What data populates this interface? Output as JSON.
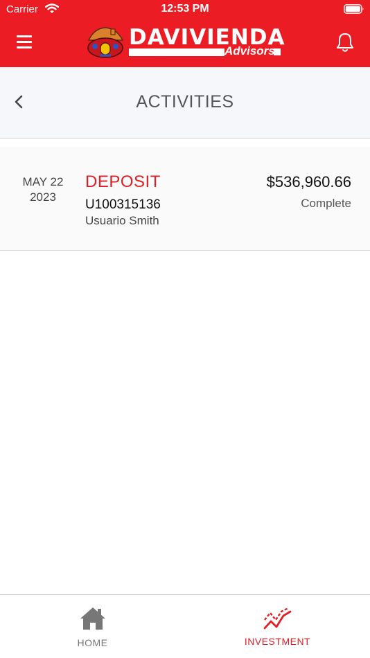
{
  "status_bar": {
    "carrier": "Carrier",
    "time": "12:53 PM"
  },
  "header": {
    "logo_brand": "DAVIVIENDA",
    "logo_sub": "Advisors",
    "menu_icon": "hamburger-icon",
    "notification_icon": "bell-icon"
  },
  "title_bar": {
    "title": "ACTIVITIES",
    "back_icon": "chevron-left-icon"
  },
  "activities": [
    {
      "date_month_day": "MAY 22",
      "date_year": "2023",
      "type": "DEPOSIT",
      "account_id": "U100315136",
      "account_name": "Usuario Smith",
      "amount": "$536,960.66",
      "status": "Complete"
    }
  ],
  "tabs": [
    {
      "label": "HOME",
      "icon": "home-icon",
      "active": false
    },
    {
      "label": "INVESTMENT",
      "icon": "investment-chart-icon",
      "active": true
    }
  ],
  "colors": {
    "brand_red": "#ec1c24",
    "accent_red": "#e21d23",
    "title_bar_bg": "#f6f7fb"
  }
}
